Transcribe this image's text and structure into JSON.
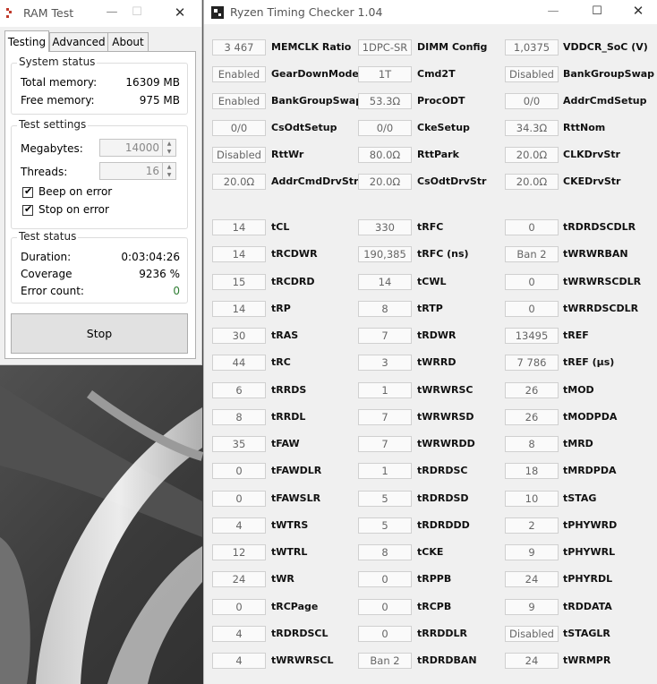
{
  "ram_test": {
    "title": "RAM Test",
    "window_buttons": {
      "minimize": "—",
      "maximize": "☐",
      "close": "✕"
    },
    "tabs": [
      "Testing",
      "Advanced",
      "About"
    ],
    "system_status": {
      "title": "System status",
      "total_label": "Total memory:",
      "total_value": "16309 MB",
      "free_label": "Free memory:",
      "free_value": "975 MB"
    },
    "test_settings": {
      "title": "Test settings",
      "megabytes_label": "Megabytes:",
      "megabytes_value": "14000",
      "threads_label": "Threads:",
      "threads_value": "16",
      "beep_label": "Beep on error",
      "beep_checked": true,
      "stop_label": "Stop on error",
      "stop_checked": true
    },
    "test_status": {
      "title": "Test status",
      "duration_label": "Duration:",
      "duration_value": "0:03:04:26",
      "coverage_label": "Coverage",
      "coverage_value": "9236 %",
      "errors_label": "Error count:",
      "errors_value": "0"
    },
    "stop_button": "Stop"
  },
  "rtc": {
    "title": "Ryzen Timing Checker 1.04",
    "window_buttons": {
      "minimize": "—",
      "maximize": "☐",
      "close": "✕"
    },
    "config_rows": [
      [
        {
          "value": "3 467",
          "label": "MEMCLK Ratio"
        },
        {
          "value": "1DPC-SR",
          "label": "DIMM Config"
        },
        {
          "value": "1,0375",
          "label": "VDDCR_SoC (V)"
        }
      ],
      [
        {
          "value": "Enabled",
          "label": "GearDownMode"
        },
        {
          "value": "1T",
          "label": "Cmd2T"
        },
        {
          "value": "Disabled",
          "label": "BankGroupSwap"
        }
      ],
      [
        {
          "value": "Enabled",
          "label": "BankGroupSwapAlt"
        },
        {
          "value": "53.3Ω",
          "label": "ProcODT"
        },
        {
          "value": "0/0",
          "label": "AddrCmdSetup"
        }
      ],
      [
        {
          "value": "0/0",
          "label": "CsOdtSetup"
        },
        {
          "value": "0/0",
          "label": "CkeSetup"
        },
        {
          "value": "34.3Ω",
          "label": "RttNom"
        }
      ],
      [
        {
          "value": "Disabled",
          "label": "RttWr"
        },
        {
          "value": "80.0Ω",
          "label": "RttPark"
        },
        {
          "value": "20.0Ω",
          "label": "CLKDrvStr"
        }
      ],
      [
        {
          "value": "20.0Ω",
          "label": "AddrCmdDrvStr"
        },
        {
          "value": "20.0Ω",
          "label": "CsOdtDrvStr"
        },
        {
          "value": "20.0Ω",
          "label": "CKEDrvStr"
        }
      ]
    ],
    "timing_rows": [
      [
        {
          "value": "14",
          "label": "tCL"
        },
        {
          "value": "330",
          "label": "tRFC"
        },
        {
          "value": "0",
          "label": "tRDRDSCDLR"
        }
      ],
      [
        {
          "value": "14",
          "label": "tRCDWR"
        },
        {
          "value": "190,385",
          "label": "tRFC (ns)"
        },
        {
          "value": "Ban 2",
          "label": "tWRWRBAN"
        }
      ],
      [
        {
          "value": "15",
          "label": "tRCDRD"
        },
        {
          "value": "14",
          "label": "tCWL"
        },
        {
          "value": "0",
          "label": "tWRWRSCDLR"
        }
      ],
      [
        {
          "value": "14",
          "label": "tRP"
        },
        {
          "value": "8",
          "label": "tRTP"
        },
        {
          "value": "0",
          "label": "tWRRDSCDLR"
        }
      ],
      [
        {
          "value": "30",
          "label": "tRAS"
        },
        {
          "value": "7",
          "label": "tRDWR"
        },
        {
          "value": "13495",
          "label": "tREF"
        }
      ],
      [
        {
          "value": "44",
          "label": "tRC"
        },
        {
          "value": "3",
          "label": "tWRRD"
        },
        {
          "value": "7 786",
          "label": "tREF (µs)"
        }
      ],
      [
        {
          "value": "6",
          "label": "tRRDS"
        },
        {
          "value": "1",
          "label": "tWRWRSC"
        },
        {
          "value": "26",
          "label": "tMOD"
        }
      ],
      [
        {
          "value": "8",
          "label": "tRRDL"
        },
        {
          "value": "7",
          "label": "tWRWRSD"
        },
        {
          "value": "26",
          "label": "tMODPDA"
        }
      ],
      [
        {
          "value": "35",
          "label": "tFAW"
        },
        {
          "value": "7",
          "label": "tWRWRDD"
        },
        {
          "value": "8",
          "label": "tMRD"
        }
      ],
      [
        {
          "value": "0",
          "label": "tFAWDLR"
        },
        {
          "value": "1",
          "label": "tRDRDSC"
        },
        {
          "value": "18",
          "label": "tMRDPDA"
        }
      ],
      [
        {
          "value": "0",
          "label": "tFAWSLR"
        },
        {
          "value": "5",
          "label": "tRDRDSD"
        },
        {
          "value": "10",
          "label": "tSTAG"
        }
      ],
      [
        {
          "value": "4",
          "label": "tWTRS"
        },
        {
          "value": "5",
          "label": "tRDRDDD"
        },
        {
          "value": "2",
          "label": "tPHYWRD"
        }
      ],
      [
        {
          "value": "12",
          "label": "tWTRL"
        },
        {
          "value": "8",
          "label": "tCKE"
        },
        {
          "value": "9",
          "label": "tPHYWRL"
        }
      ],
      [
        {
          "value": "24",
          "label": "tWR"
        },
        {
          "value": "0",
          "label": "tRPPB"
        },
        {
          "value": "24",
          "label": "tPHYRDL"
        }
      ],
      [
        {
          "value": "0",
          "label": "tRCPage"
        },
        {
          "value": "0",
          "label": "tRCPB"
        },
        {
          "value": "9",
          "label": "tRDDATA"
        }
      ],
      [
        {
          "value": "4",
          "label": "tRDRDSCL"
        },
        {
          "value": "0",
          "label": "tRRDDLR"
        },
        {
          "value": "Disabled",
          "label": "tSTAGLR"
        }
      ],
      [
        {
          "value": "4",
          "label": "tWRWRSCL"
        },
        {
          "value": "Ban 2",
          "label": "tRDRDBAN"
        },
        {
          "value": "24",
          "label": "tWRMPR"
        }
      ]
    ]
  },
  "colors": {
    "error_count": "#2e7d32",
    "accent": "#0078d7"
  }
}
